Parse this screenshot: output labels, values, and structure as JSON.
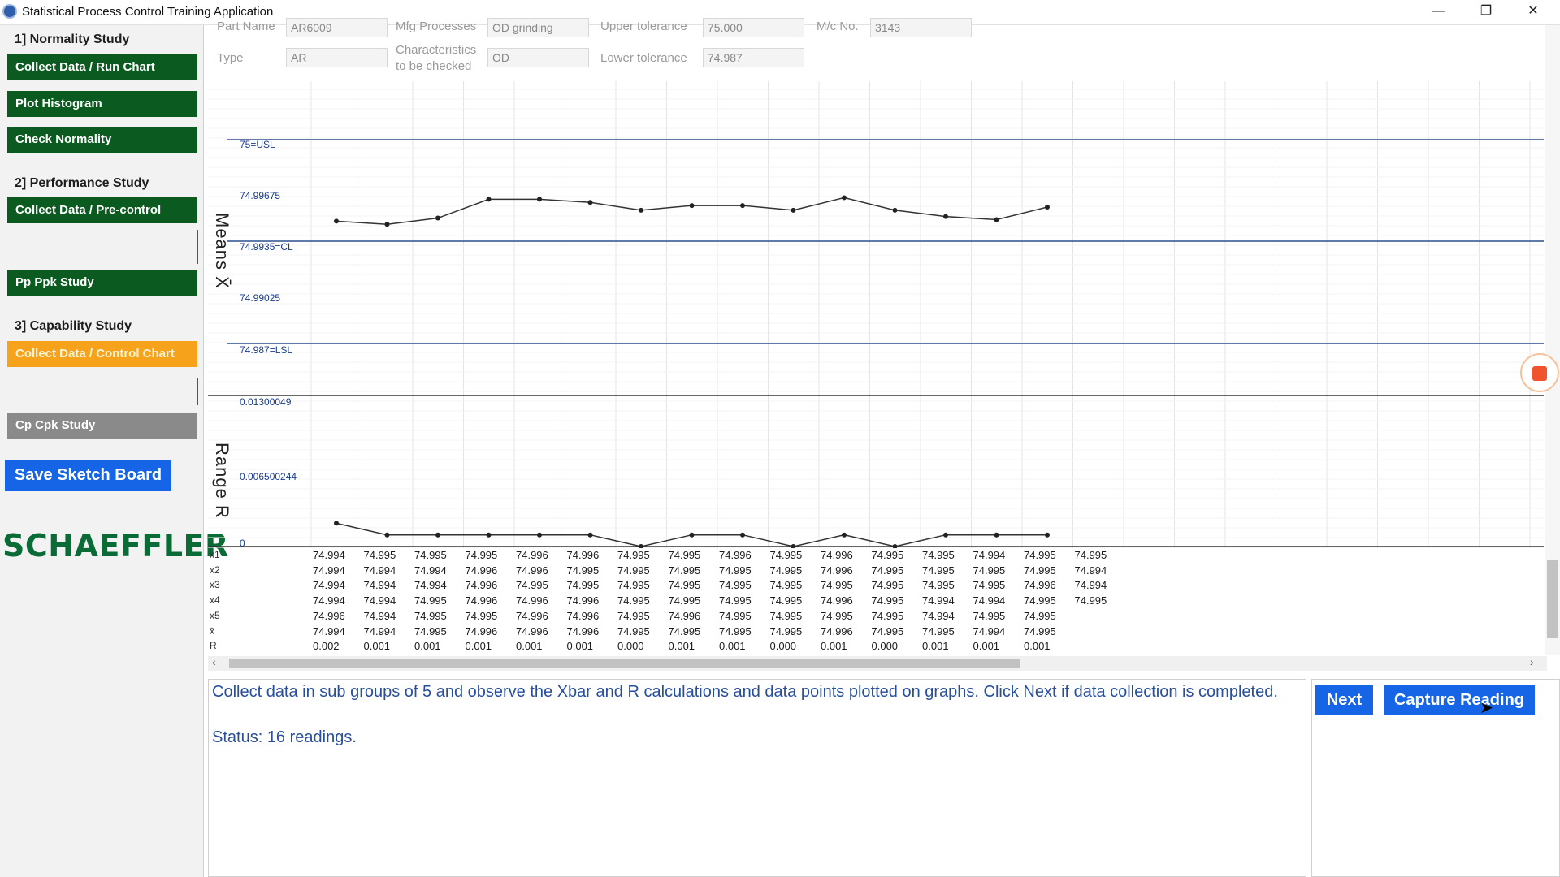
{
  "window": {
    "title": "Statistical Process Control Training Application",
    "controls": {
      "minimize": "—",
      "restore": "❐",
      "close": "✕"
    }
  },
  "sidebar": {
    "section1": "1] Normality Study",
    "btn_collect_run": "Collect Data / Run Chart",
    "btn_histogram": "Plot Histogram",
    "btn_normality": "Check Normality",
    "section2": "2] Performance Study",
    "btn_precontrol": "Collect Data / Pre-control",
    "btn_ppk": "Pp Ppk Study",
    "section3": "3] Capability Study",
    "btn_control_chart": "Collect Data / Control Chart",
    "btn_cpk": "Cp Cpk Study",
    "save_sketch": "Save Sketch Board",
    "logo": "SCHAEFFLER"
  },
  "info_fields": {
    "part_name_label": "Part Name",
    "part_name_value": "AR6009",
    "mfg_label": "Mfg Processes",
    "mfg_value": "OD grinding",
    "upper_tol_label": "Upper tolerance",
    "upper_tol_value": "75.000",
    "mc_label": "M/c No.",
    "mc_value": "3143",
    "type_label": "Type",
    "type_value": "AR",
    "char_label_1": "Characteristics",
    "char_label_2": "to be checked",
    "char_value": "OD",
    "lower_tol_label": "Lower tolerance",
    "lower_tol_value": "74.987"
  },
  "chart_data": [
    {
      "type": "line",
      "ylabel": "Means X̄",
      "tick_labels": [
        "75=USL",
        "74.99675",
        "74.9935=CL",
        "74.99025",
        "74.987=LSL"
      ],
      "ylim": [
        74.987,
        75.0
      ],
      "limits": {
        "USL": 75.0,
        "CL": 74.9935,
        "LSL": 74.987
      },
      "x": [
        1,
        2,
        3,
        4,
        5,
        6,
        7,
        8,
        9,
        10,
        11,
        12,
        13,
        14,
        15
      ],
      "values": [
        74.9948,
        74.9946,
        74.995,
        74.9962,
        74.9962,
        74.996,
        74.9955,
        74.9958,
        74.9958,
        74.9955,
        74.9963,
        74.9955,
        74.9951,
        74.9949,
        74.9957
      ],
      "grid": true
    },
    {
      "type": "line",
      "ylabel": "Range R",
      "tick_labels": [
        "0.01300049",
        "0.006500244",
        "0"
      ],
      "ylim": [
        0,
        0.01300049
      ],
      "x": [
        1,
        2,
        3,
        4,
        5,
        6,
        7,
        8,
        9,
        10,
        11,
        12,
        13,
        14,
        15
      ],
      "values": [
        0.002,
        0.001,
        0.001,
        0.001,
        0.001,
        0.001,
        0.0,
        0.001,
        0.001,
        0.0,
        0.001,
        0.0,
        0.001,
        0.001,
        0.001
      ],
      "grid": true
    }
  ],
  "table": {
    "row_labels": [
      "x1",
      "x2",
      "x3",
      "x4",
      "x5",
      "x̄",
      "R"
    ],
    "rows": [
      [
        "74.994",
        "74.995",
        "74.995",
        "74.995",
        "74.996",
        "74.996",
        "74.995",
        "74.995",
        "74.996",
        "74.995",
        "74.996",
        "74.995",
        "74.995",
        "74.994",
        "74.995",
        "74.995"
      ],
      [
        "74.994",
        "74.994",
        "74.994",
        "74.996",
        "74.996",
        "74.995",
        "74.995",
        "74.995",
        "74.995",
        "74.995",
        "74.996",
        "74.995",
        "74.995",
        "74.995",
        "74.995",
        "74.994"
      ],
      [
        "74.994",
        "74.994",
        "74.994",
        "74.996",
        "74.995",
        "74.995",
        "74.995",
        "74.995",
        "74.995",
        "74.995",
        "74.995",
        "74.995",
        "74.995",
        "74.995",
        "74.996",
        "74.994"
      ],
      [
        "74.994",
        "74.994",
        "74.995",
        "74.996",
        "74.996",
        "74.996",
        "74.995",
        "74.995",
        "74.995",
        "74.995",
        "74.996",
        "74.995",
        "74.994",
        "74.994",
        "74.995",
        "74.995"
      ],
      [
        "74.996",
        "74.994",
        "74.995",
        "74.995",
        "74.996",
        "74.996",
        "74.995",
        "74.996",
        "74.995",
        "74.995",
        "74.995",
        "74.995",
        "74.994",
        "74.995",
        "74.995"
      ],
      [
        "74.994",
        "74.994",
        "74.995",
        "74.996",
        "74.996",
        "74.996",
        "74.995",
        "74.995",
        "74.995",
        "74.995",
        "74.996",
        "74.995",
        "74.995",
        "74.994",
        "74.995"
      ],
      [
        "0.002",
        "0.001",
        "0.001",
        "0.001",
        "0.001",
        "0.001",
        "0.000",
        "0.001",
        "0.001",
        "0.000",
        "0.001",
        "0.000",
        "0.001",
        "0.001",
        "0.001"
      ]
    ]
  },
  "message": {
    "text": "Collect data in sub groups of 5 and observe the Xbar and R calculations and data points plotted on graphs. Click Next if data collection is completed.",
    "status": "Status: 16 readings."
  },
  "buttons": {
    "next": "Next",
    "capture": "Capture Reading"
  },
  "colors": {
    "dark_green": "#0b5a1f",
    "orange": "#f7a21b",
    "blue": "#1565e6",
    "logo_green": "#0a6b37",
    "limit_line": "#2a4f8f"
  }
}
